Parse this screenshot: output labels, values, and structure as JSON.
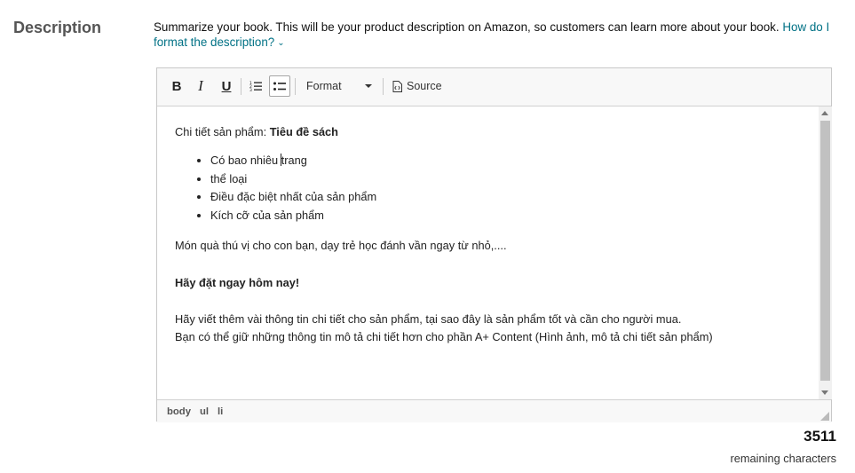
{
  "section": {
    "label": "Description"
  },
  "intro": {
    "text": "Summarize your book. This will be your product description on Amazon, so customers can learn more about your book.",
    "help_link": "How do I format the description?"
  },
  "toolbar": {
    "bold_label": "B",
    "italic_label": "I",
    "underline_label": "U",
    "format_label": "Format",
    "source_label": "Source"
  },
  "content": {
    "title_prefix": "Chi tiết sản phẩm: ",
    "title_bold": "Tiêu đề sách",
    "bullets": [
      {
        "before": "Có bao nhiêu ",
        "after": "trang"
      },
      {
        "text": "thể loại"
      },
      {
        "text": "Điều đặc biệt nhất của sản phẩm"
      },
      {
        "text": "Kích cỡ của sản phẩm"
      }
    ],
    "gift": "Món quà thú vị cho con bạn, dạy trẻ học đánh vần ngay từ nhỏ,....",
    "order": "Hãy đặt ngay hôm nay!",
    "write_line1": "Hãy viết thêm vài thông tin chi tiết cho sản phẩm, tại sao đây là sản phẩm tốt và cần cho người mua.",
    "write_line2": "Bạn có thể giữ những thông tin mô tả chi tiết hơn cho phần A+ Content (Hình ảnh, mô tả chi tiết sản phẩm)"
  },
  "status_path": [
    "body",
    "ul",
    "li"
  ],
  "counter": {
    "value": "3511",
    "label": "remaining characters"
  },
  "colors": {
    "link": "#007185",
    "label_gray": "#555555",
    "toolbar_bg": "#f8f8f8"
  },
  "icons": {
    "ordered_list": "numbered-list-icon",
    "unordered_list": "bulleted-list-icon",
    "source": "source-code-icon",
    "format_dropdown": "chevron-down-icon",
    "help": "chevron-down-icon"
  }
}
